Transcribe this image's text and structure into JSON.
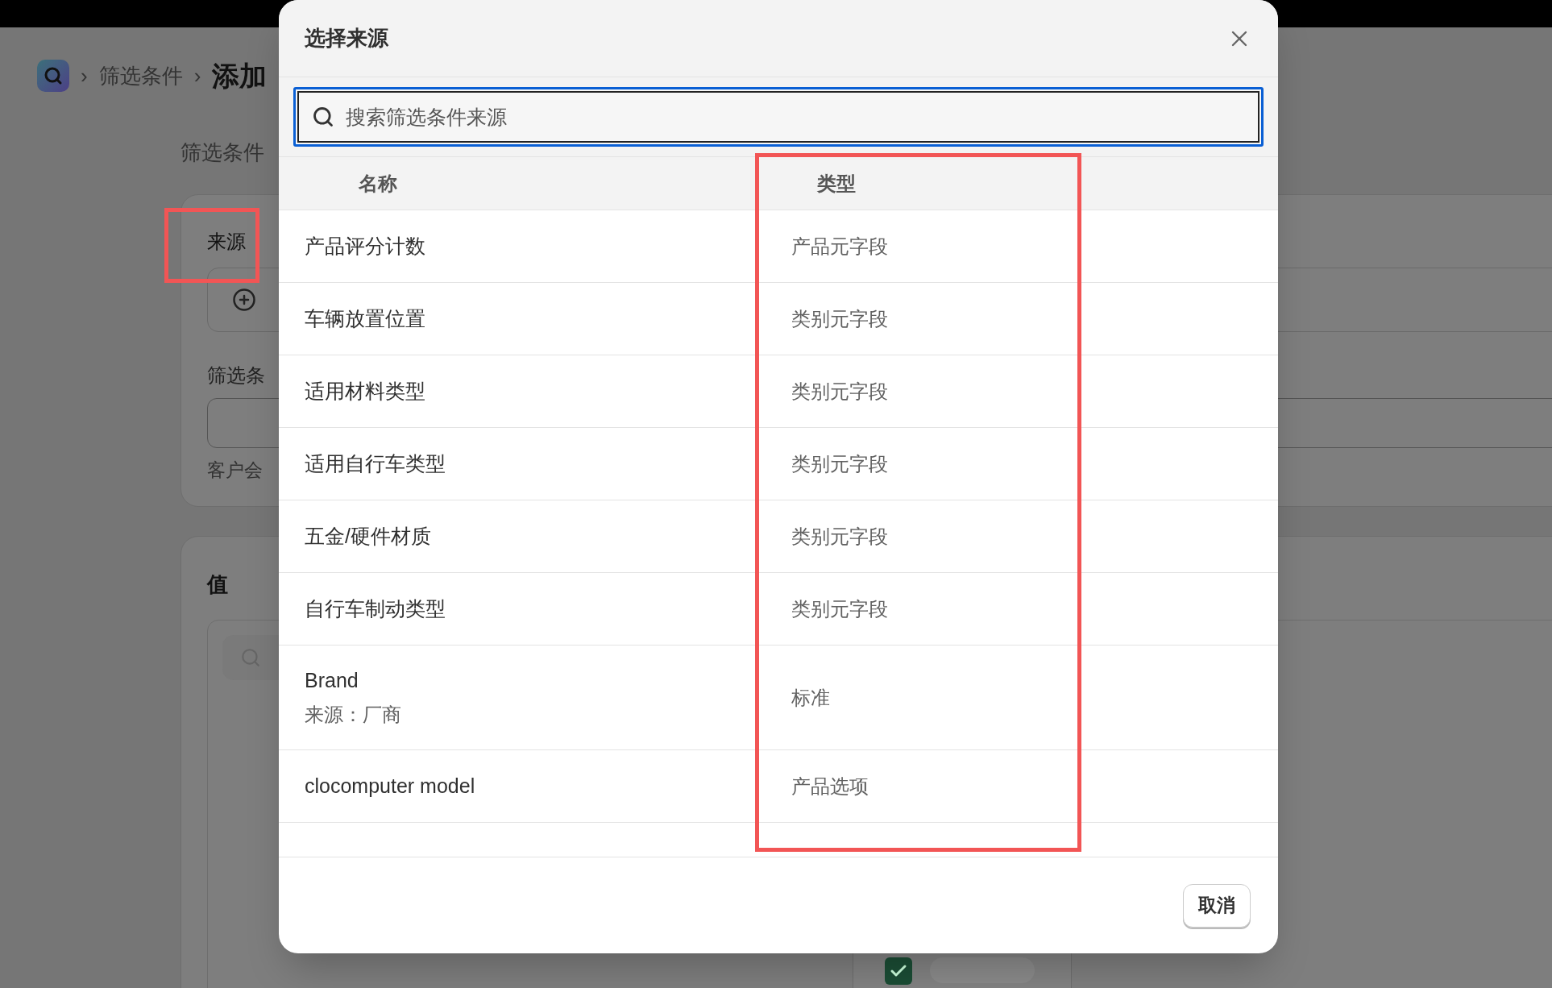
{
  "background": {
    "breadcrumb": [
      {
        "text": "筛选条件",
        "kind": "link"
      },
      {
        "text": "添加",
        "kind": "current"
      }
    ],
    "separator": "›",
    "section_title": "筛选条件",
    "source_label": "来源",
    "filter_label": "筛选条",
    "help_text": "客户会",
    "value_title": "值",
    "value_option": {
      "checked": true
    }
  },
  "dialog": {
    "title": "选择来源",
    "search": {
      "placeholder": "搜索筛选条件来源"
    },
    "columns": [
      "名称",
      "类型"
    ],
    "rows": [
      {
        "name": "产品评分计数",
        "type": "产品元字段"
      },
      {
        "name": "车辆放置位置",
        "type": "类别元字段"
      },
      {
        "name": "适用材料类型",
        "type": "类别元字段"
      },
      {
        "name": "适用自行车类型",
        "type": "类别元字段"
      },
      {
        "name": "五金/硬件材质",
        "type": "类别元字段"
      },
      {
        "name": "自行车制动类型",
        "type": "类别元字段"
      },
      {
        "name": "Brand",
        "subtitle": "来源：厂商",
        "type": "标准"
      },
      {
        "name": "clocomputer model",
        "type": "产品选项"
      }
    ],
    "buttons": [
      "取消"
    ]
  }
}
